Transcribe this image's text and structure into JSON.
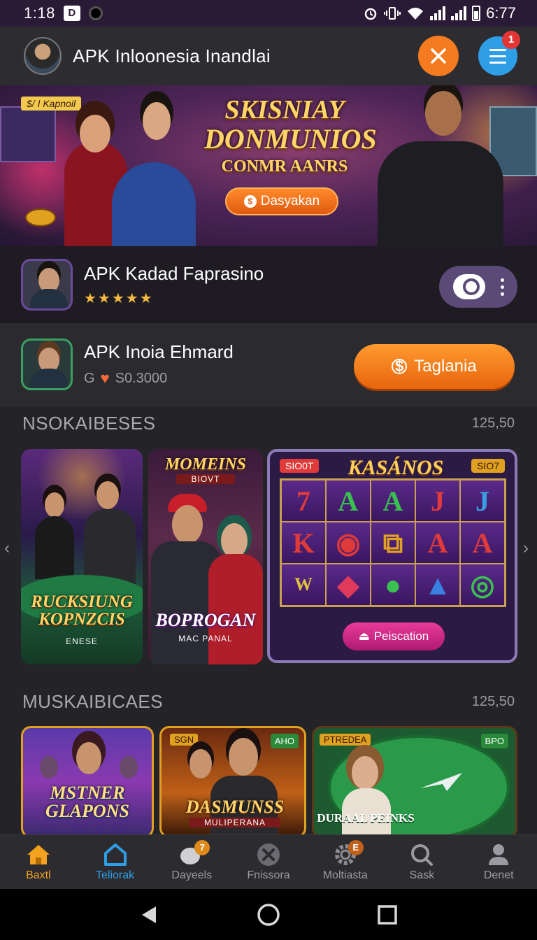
{
  "status_bar": {
    "time": "1:18",
    "notif_box": "D",
    "battery_text": "6:77"
  },
  "app_header": {
    "title": "APK Inloonesia Inandlai",
    "menu_badge": "1"
  },
  "banner": {
    "tag": "$/ I Kapnoil",
    "title_line1": "SKISNIAY",
    "title_line2": "DONMUNIOS",
    "title_line3": "CONMR AANRS",
    "button_label": "Dasyakan",
    "button_icon_char": "$"
  },
  "featured_app": {
    "title": "APK Kadad Faprasino",
    "stars": "★★★★★"
  },
  "second_app": {
    "title": "APK Inoia Ehmard",
    "meta_prefix": "G",
    "meta_amount": "S0.3000",
    "cta_label": "Taglania",
    "cta_icon_char": "$"
  },
  "section1": {
    "title": "NSOKAIBESES",
    "count": "125,50",
    "cards": [
      {
        "line1": "RUCKSIUNG",
        "line2": "KOPNZCIS",
        "sub": "ENESE"
      },
      {
        "top": "MOMEINS",
        "top_sub": "BIOVT",
        "line1": "BOPROGAN",
        "sub": "MAC PANAL"
      }
    ],
    "slot": {
      "title": "KASÁNOS",
      "tag_left": "SIO0T",
      "tag_right": "SIO7",
      "symbols": [
        "7",
        "A",
        "A",
        "J",
        "J",
        "K",
        "◉",
        "⧉",
        "A",
        "A",
        "W",
        "◆",
        "●",
        "▲",
        "◎"
      ],
      "button_label": "Peiscation"
    }
  },
  "section2": {
    "title": "MUSKAIBICAES",
    "count": "125,50",
    "cards": [
      {
        "line1": "MSTNER",
        "line2": "GLAPONS"
      },
      {
        "tag": "SGN",
        "badge": "AHO",
        "line1": "DASMUNSS",
        "sub": "MULIPERANA"
      },
      {
        "tag": "PTREDEA",
        "badge": "BPO",
        "line1": "DURAAL PEINKS"
      }
    ]
  },
  "bottom_nav": [
    {
      "label": "Baxtl",
      "icon": "home-icon",
      "active": true
    },
    {
      "label": "Teliorak",
      "icon": "store-icon",
      "active": false
    },
    {
      "label": "Dayeels",
      "icon": "chat-icon",
      "badge": "7"
    },
    {
      "label": "Fnissora",
      "icon": "close-circle-icon"
    },
    {
      "label": "Moltiasta",
      "icon": "gear-icon",
      "badge": "E"
    },
    {
      "label": "Sask",
      "icon": "search-icon"
    },
    {
      "label": "Denet",
      "icon": "person-icon"
    }
  ],
  "colors": {
    "accent_orange": "#f47b20",
    "accent_blue": "#2e9ee6",
    "nav_active_home": "#f2a21e",
    "nav_active_tab": "#2e9ee6"
  }
}
